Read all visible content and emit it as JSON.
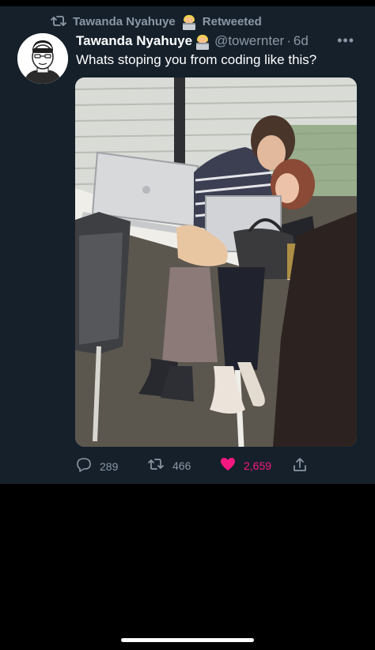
{
  "retweet": {
    "retweeter": "Tawanda Nyahuye",
    "label": "Retweeted",
    "icon": "retweet-icon"
  },
  "tweet": {
    "author_name": "Tawanda Nyahuye",
    "handle": "@towernter",
    "separator": "·",
    "time": "6d",
    "text": "Whats stoping you from coding like this?",
    "more_icon": "more-icon",
    "media_description_icon": "photo"
  },
  "actions": {
    "reply_count": "289",
    "retweet_count": "466",
    "like_count": "2,659",
    "reply_icon": "reply-icon",
    "retweet_icon": "retweet-icon",
    "like_icon": "heart-icon",
    "share_icon": "share-icon"
  },
  "colors": {
    "background": "#15202b",
    "secondary_text": "#8b98a5",
    "like_active": "#f91880"
  }
}
